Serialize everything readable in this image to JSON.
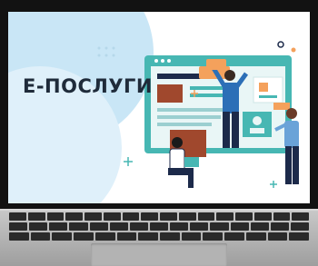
{
  "screen": {
    "title": "Е-ПОСЛУГИ"
  },
  "colors": {
    "accent": "#47b7b3",
    "orange": "#f4a15c",
    "brown": "#a0482d",
    "navy": "#1c2a4a",
    "background_circle": "#c9e6f6"
  },
  "icons": [
    "browser-window-illustration",
    "people-illustration",
    "sparkle-icon",
    "chat-bubble-icon",
    "profile-card-icon"
  ]
}
